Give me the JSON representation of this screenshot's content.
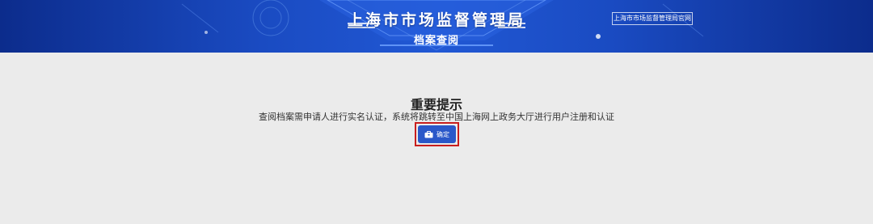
{
  "header": {
    "site_title": "上海市市场监督管理局",
    "sub_title": "档案查阅",
    "official_link_label": "上海市市场监督管理局官网"
  },
  "notice": {
    "title": "重要提示",
    "message": "查阅档案需申请人进行实名认证，系统将跳转至中国上海网上政务大厅进行用户注册和认证",
    "confirm_label": "确定"
  },
  "colors": {
    "banner_blue": "#1a4bc2",
    "button_blue": "#2a58c9",
    "highlight_red": "#c81e1e",
    "page_background": "#ebebeb"
  },
  "icons": {
    "confirm_icon": "briefcase-icon"
  }
}
